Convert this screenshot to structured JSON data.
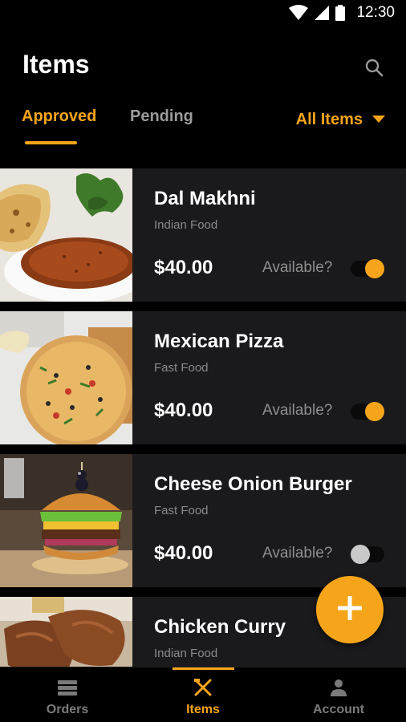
{
  "status_bar": {
    "time": "12:30"
  },
  "header": {
    "title": "Items",
    "tabs": [
      {
        "label": "Approved",
        "active": true
      },
      {
        "label": "Pending",
        "active": false
      }
    ],
    "filter": {
      "label": "All Items"
    }
  },
  "items": [
    {
      "name": "Dal Makhni",
      "category": "Indian Food",
      "price": "$40.00",
      "available_label": "Available?",
      "available": true
    },
    {
      "name": "Mexican Pizza",
      "category": "Fast Food",
      "price": "$40.00",
      "available_label": "Available?",
      "available": true
    },
    {
      "name": "Cheese Onion Burger",
      "category": "Fast Food",
      "price": "$40.00",
      "available_label": "Available?",
      "available": false
    },
    {
      "name": "Chicken Curry",
      "category": "Indian Food"
    }
  ],
  "bottom_nav": [
    {
      "label": "Orders",
      "icon": "list-icon",
      "active": false
    },
    {
      "label": "Items",
      "icon": "fork-knife-icon",
      "active": true
    },
    {
      "label": "Account",
      "icon": "person-icon",
      "active": false
    }
  ],
  "colors": {
    "accent": "#f6a51b",
    "card": "#1a1a1c",
    "background": "#000000"
  }
}
